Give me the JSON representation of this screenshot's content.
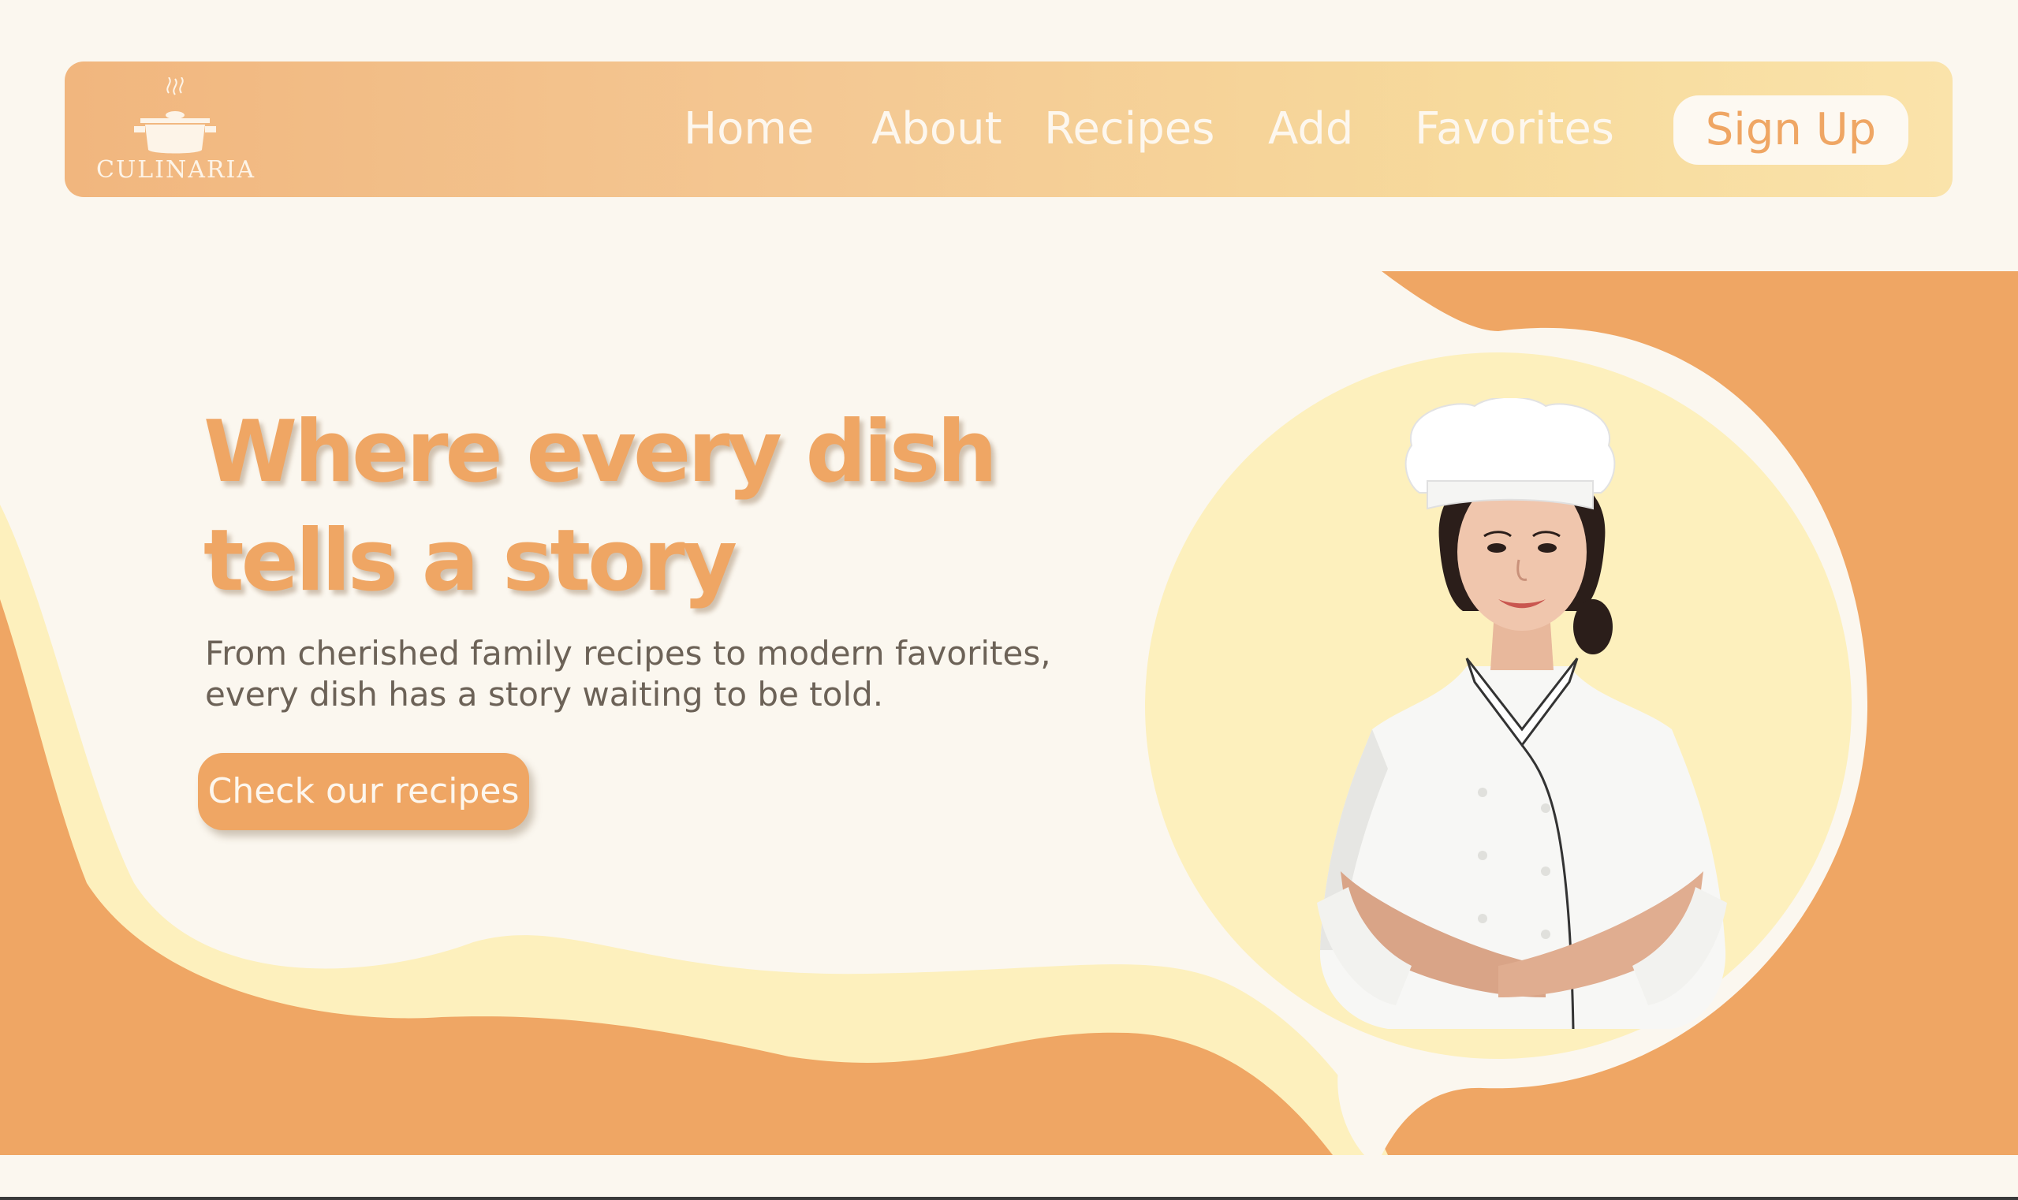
{
  "brand": {
    "name": "CULINARIA",
    "logo_icon": "cooking-pot-icon"
  },
  "nav": {
    "items": [
      {
        "label": "Home"
      },
      {
        "label": "About"
      },
      {
        "label": "Recipes"
      },
      {
        "label": "Add"
      },
      {
        "label": "Favorites"
      }
    ],
    "signup_label": "Sign Up"
  },
  "hero": {
    "title_line1": "Where every dish",
    "title_line2": "tells a story",
    "subtitle_line1": "From cherished family recipes to modern favorites,",
    "subtitle_line2": "every dish has a story waiting to be told.",
    "cta_label": "Check our recipes",
    "image_icon": "chef-portrait"
  },
  "colors": {
    "background": "#fbf7ef",
    "accent_orange": "#efa664",
    "accent_yellow": "#fdf0bd",
    "text_muted": "#6c6257"
  }
}
